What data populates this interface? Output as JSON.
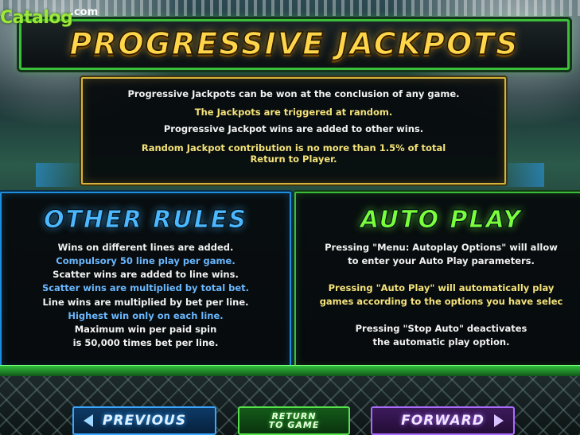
{
  "logo": {
    "main": "Catalog",
    "suffix": ".com"
  },
  "banner": {
    "title": "PROGRESSIVE JACKPOTS"
  },
  "jackpots": {
    "lines": [
      {
        "text": "Progressive Jackpots can be won at the conclusion of any game.",
        "color": "white"
      },
      {
        "text": "The Jackpots are triggered at random.",
        "color": "yellow"
      },
      {
        "text": "Progressive Jackpot wins are added to other wins.",
        "color": "white"
      },
      {
        "text": "Random Jackpot contribution is no more than 1.5% of total",
        "color": "yellow"
      },
      {
        "text": "Return to Player.",
        "color": "yellow"
      }
    ]
  },
  "other_rules": {
    "title": "OTHER RULES",
    "lines": [
      {
        "text": "Wins on different lines are added.",
        "color": "white"
      },
      {
        "text": "Compulsory 50 line play per game.",
        "color": "blue"
      },
      {
        "text": "Scatter wins are added to line wins.",
        "color": "white"
      },
      {
        "text": "Scatter wins are multiplied by total bet.",
        "color": "blue"
      },
      {
        "text": "Line wins are multiplied by bet per line.",
        "color": "white"
      },
      {
        "text": "Highest win only on each line.",
        "color": "blue"
      },
      {
        "text": "Maximum win per paid spin",
        "color": "white"
      },
      {
        "text": "is 50,000 times bet per line.",
        "color": "white"
      }
    ]
  },
  "auto_play": {
    "title": "AUTO PLAY",
    "lines": [
      {
        "text": "Pressing \"Menu: Autoplay Options\" will allow",
        "color": "white"
      },
      {
        "text": "to enter your Auto Play parameters.",
        "color": "white"
      },
      {
        "text": "",
        "color": "white"
      },
      {
        "text": "Pressing \"Auto Play\" will automatically play",
        "color": "yellow"
      },
      {
        "text": "games according to the options you have selec",
        "color": "yellow"
      },
      {
        "text": "",
        "color": "white"
      },
      {
        "text": "Pressing \"Stop Auto\" deactivates",
        "color": "white"
      },
      {
        "text": "the automatic play option.",
        "color": "white"
      }
    ]
  },
  "buttons": {
    "previous": "PREVIOUS",
    "return_line1": "RETURN",
    "return_line2": "TO GAME",
    "forward": "FORWARD"
  },
  "colors": {
    "gold": "#ffd54a",
    "green": "#3bbf3a",
    "blue": "#1c8fe0",
    "purple": "#a96cff"
  }
}
